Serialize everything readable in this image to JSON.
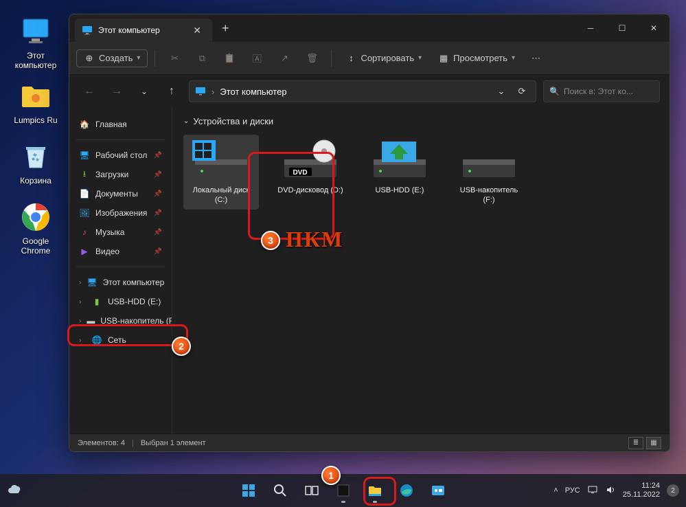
{
  "desktop": {
    "icons": [
      {
        "label": "Этот компьютер"
      },
      {
        "label": "Lumpics Ru"
      },
      {
        "label": "Корзина"
      },
      {
        "label": "Google Chrome"
      }
    ]
  },
  "window": {
    "tab_title": "Этот компьютер",
    "toolbar": {
      "create": "Создать",
      "sort": "Сортировать",
      "view": "Просмотреть"
    },
    "address": {
      "location": "Этот компьютер"
    },
    "search_placeholder": "Поиск в: Этот ко...",
    "sidebar": {
      "home": "Главная",
      "quick": [
        {
          "label": "Рабочий стол"
        },
        {
          "label": "Загрузки"
        },
        {
          "label": "Документы"
        },
        {
          "label": "Изображения"
        },
        {
          "label": "Музыка"
        },
        {
          "label": "Видео"
        }
      ],
      "tree": [
        {
          "label": "Этот компьютер"
        },
        {
          "label": "USB-HDD (E:)"
        },
        {
          "label": "USB-накопитель (F"
        },
        {
          "label": "Сеть"
        }
      ]
    },
    "content": {
      "section": "Устройства и диски",
      "drives": [
        {
          "label": "Локальный диск (C:)"
        },
        {
          "label": "DVD-дисковод (D:)"
        },
        {
          "label": "USB-HDD (E:)"
        },
        {
          "label": "USB-накопитель (F:)"
        }
      ],
      "dvd_badge": "DVD"
    },
    "status": {
      "count": "Элементов: 4",
      "selected": "Выбран 1 элемент"
    }
  },
  "taskbar": {
    "lang": "РУС",
    "time": "11:24",
    "date": "25.11.2022",
    "notif_count": "2"
  },
  "annotations": {
    "pkm": "ПКМ",
    "m1": "1",
    "m2": "2",
    "m3": "3"
  }
}
